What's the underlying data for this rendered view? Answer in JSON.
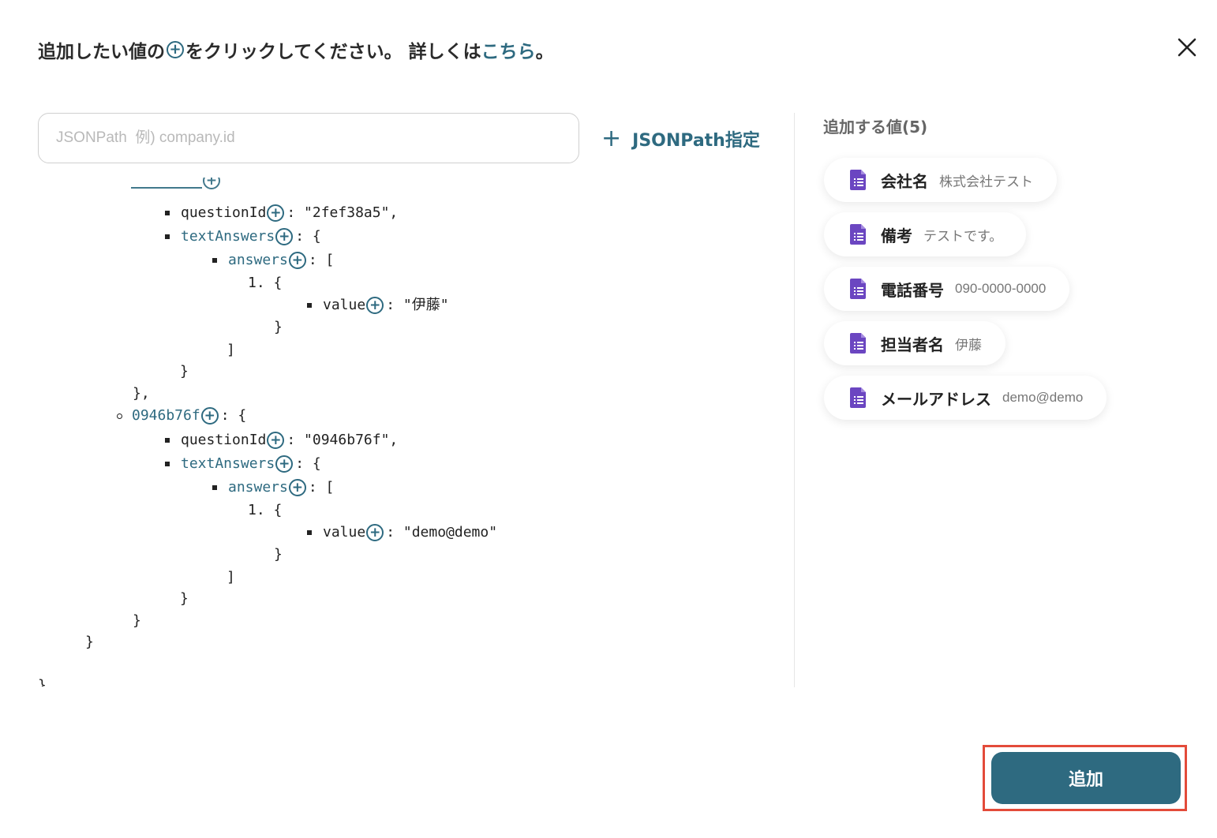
{
  "header": {
    "instruction_before": "追加したい値の",
    "plus_glyph": "+",
    "instruction_after": "をクリックしてください。 詳しくは",
    "link_text": "こちら",
    "period": "。"
  },
  "search": {
    "placeholder": "JSONPath  例) company.id",
    "value": ""
  },
  "jsonpath_button": {
    "plus": "+",
    "label": "JSONPath指定"
  },
  "tree": {
    "lines": [
      {
        "text": "questionId",
        "rest": ": \"2fef38a5\","
      },
      {
        "text": "textAnswers",
        "rest": ": {"
      },
      {
        "text": "answers",
        "rest": ": ["
      },
      {
        "text": "1. {"
      },
      {
        "text": "value",
        "rest": ": \"伊藤\""
      },
      {
        "text": "}"
      },
      {
        "text": "]"
      },
      {
        "text": "}"
      },
      {
        "text": "},"
      },
      {
        "text": "0946b76f",
        "rest": ": {"
      },
      {
        "text": "questionId",
        "rest": ": \"0946b76f\","
      },
      {
        "text": "textAnswers",
        "rest": ": {"
      },
      {
        "text": "answers",
        "rest": ": ["
      },
      {
        "text": "1. {"
      },
      {
        "text": "value",
        "rest": ": \"demo@demo\""
      },
      {
        "text": "}"
      },
      {
        "text": "]"
      },
      {
        "text": "}"
      },
      {
        "text": "}"
      },
      {
        "text": "}"
      },
      {
        "text": "}"
      }
    ]
  },
  "added": {
    "title": "追加する値(5)",
    "items": [
      {
        "label": "会社名",
        "value": "株式会社テスト"
      },
      {
        "label": "備考",
        "value": "テストです。"
      },
      {
        "label": "電話番号",
        "value": "090-0000-0000"
      },
      {
        "label": "担当者名",
        "value": "伊藤"
      },
      {
        "label": "メールアドレス",
        "value": "demo@demo"
      }
    ]
  },
  "submit": {
    "label": "追加"
  },
  "colors": {
    "accent": "#2e6a80",
    "doc_icon": "#6b46c1",
    "highlight": "#e34b3a"
  }
}
